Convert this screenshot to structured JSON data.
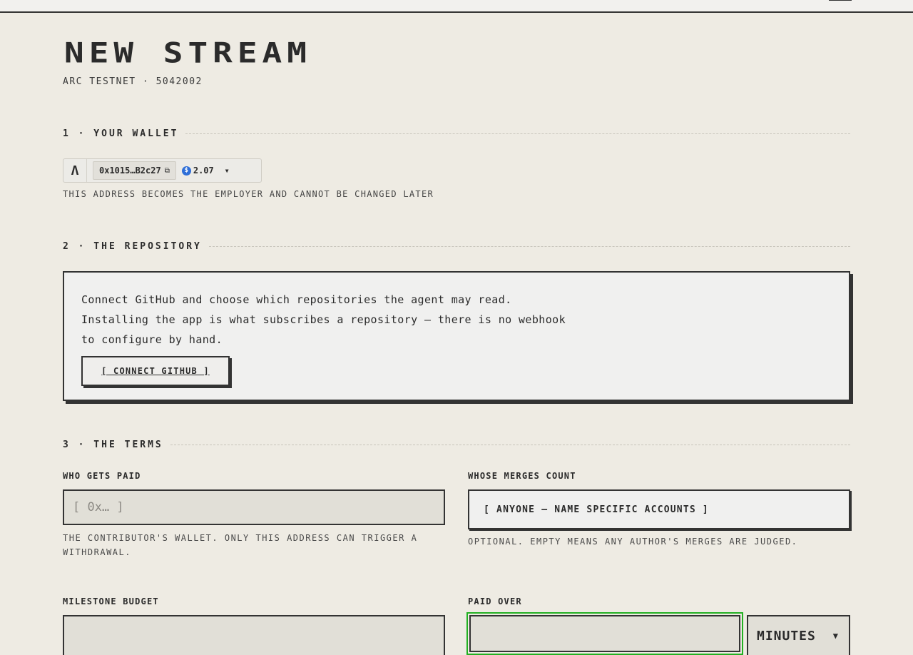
{
  "page": {
    "title": "NEW STREAM",
    "network": "ARC TESTNET · 5042002"
  },
  "wallet": {
    "heading": "1 · YOUR WALLET",
    "logo": "Λ",
    "address": "0x1015…B2c27",
    "copy_icon": "copy-icon",
    "balance": "2.07",
    "token_icon": "usdc-icon",
    "note": "THIS ADDRESS BECOMES THE EMPLOYER AND CANNOT BE CHANGED LATER"
  },
  "repository": {
    "heading": "2 · THE REPOSITORY",
    "line1": "Connect GitHub and choose which repositories the agent may read.",
    "line2": "Installing the app is what subscribes a repository — there is no webhook",
    "line3": "to configure by hand.",
    "connect_label": "[ CONNECT GITHUB ]"
  },
  "terms": {
    "heading": "3 · THE TERMS",
    "payee": {
      "label": "WHO GETS PAID",
      "placeholder": "[ 0x… ]",
      "help_line1": "THE CONTRIBUTOR'S WALLET. ONLY THIS ADDRESS CAN TRIGGER A",
      "help_line2": "WITHDRAWAL."
    },
    "authors": {
      "label": "WHOSE MERGES COUNT",
      "button_label": "[ ANYONE — NAME SPECIFIC ACCOUNTS ]",
      "help": "OPTIONAL. EMPTY MEANS ANY AUTHOR'S MERGES ARE JUDGED."
    },
    "budget": {
      "label": "MILESTONE BUDGET",
      "value": ""
    },
    "duration": {
      "label": "PAID OVER",
      "value": "",
      "unit": "MINUTES"
    }
  },
  "colors": {
    "background": "#eeebe3",
    "ink": "#2b2b2b",
    "focus": "#22b022",
    "token": "#2f6fd8"
  }
}
